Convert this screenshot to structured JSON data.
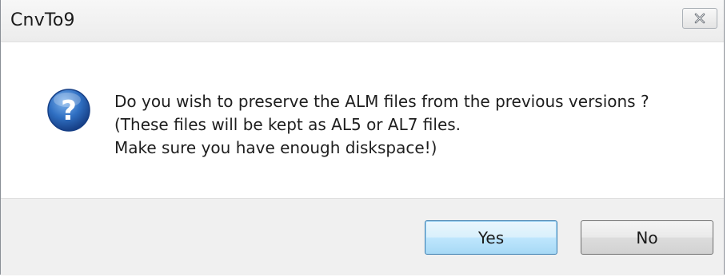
{
  "dialog": {
    "title": "CnvTo9",
    "close_icon": "close-icon",
    "question_icon": "question-icon",
    "message_lines": [
      "Do you wish to preserve the ALM files from the previous versions ?",
      "(These files will be kept as AL5 or AL7 files.",
      "Make sure you have enough diskspace!)"
    ],
    "buttons": {
      "yes_label": "Yes",
      "no_label": "No"
    }
  },
  "colors": {
    "icon_blue": "#1f5fb4",
    "default_button_border": "#3c7fb1"
  }
}
